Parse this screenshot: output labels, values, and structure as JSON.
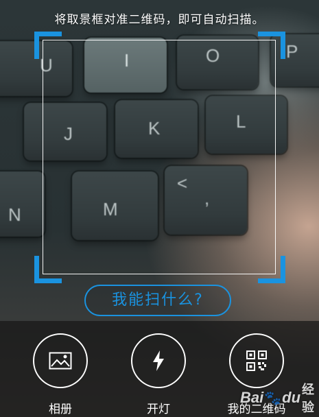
{
  "scan_hint": "将取景框对准二维码，即可自动扫描。",
  "what_can_i_scan_label": "我能扫什么?",
  "keyboard_keys": [
    "U",
    "I",
    "O",
    "P",
    "J",
    "K",
    "L",
    "N",
    "M",
    "<",
    ","
  ],
  "actions": [
    {
      "label": "相册",
      "icon": "image-icon"
    },
    {
      "label": "开灯",
      "icon": "flash-icon"
    },
    {
      "label": "我的二维码",
      "icon": "qr-code-icon"
    }
  ],
  "watermark": {
    "brand": "Bai",
    "brand2": "du",
    "suffix": "经验"
  },
  "colors": {
    "accent": "#1a93e0",
    "frame": "#ffffff"
  }
}
